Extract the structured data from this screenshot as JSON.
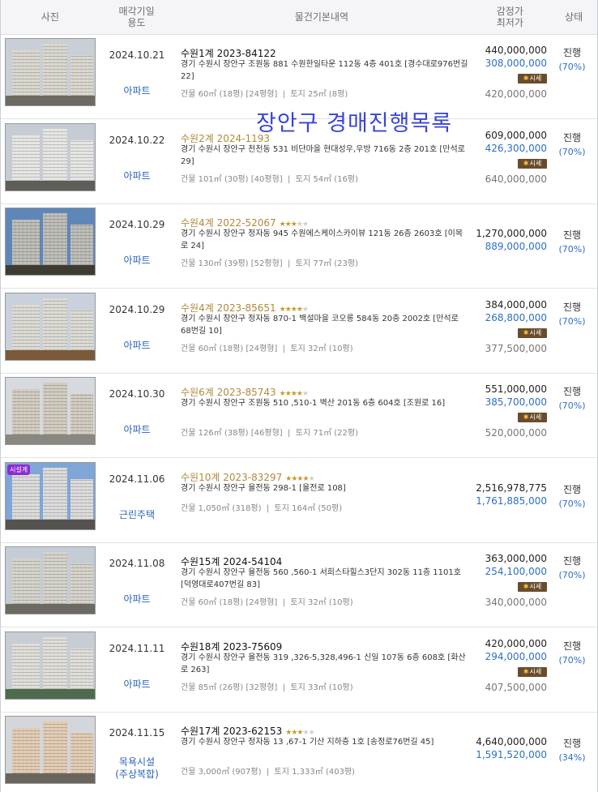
{
  "header": {
    "photo": "사진",
    "date_line1": "매각기일",
    "date_line2": "용도",
    "info": "물건기본내역",
    "price_line1": "감정가",
    "price_line2": "최저가",
    "status": "상태"
  },
  "overlay_title": "장안구 경매진행목록",
  "sise_label": "시세",
  "rows": [
    {
      "date": "2024.10.21",
      "type": "아파트",
      "case": "수원1계 2023-84122",
      "case_style": "plain",
      "stars": 0,
      "addr": "경기 수원시 장안구 조원동 881 수원한일타운 112동 4층 401호 [경수대로976번길 22]",
      "area": "건물 60㎡ (18평) [24평형]  |  토지 25㎡ (8평)",
      "appraisal": "440,000,000",
      "minimum": "308,000,000",
      "prev": "420,000,000",
      "has_sise": true,
      "status": "진행",
      "pct": "(70%)",
      "photo": {
        "sky": "#c9cfd7",
        "bldg": "#d8d5cc",
        "ground": "#6d6a62"
      }
    },
    {
      "date": "2024.10.22",
      "type": "아파트",
      "case": "수원2계 2024-1193",
      "case_style": "gold",
      "stars": 0,
      "addr": "경기 수원시 장안구 천천동 531 비단마을 현대성우,우방 716동 2층 201호 [만석로 29]",
      "area": "건물 101㎡ (30평) [40평형]  |  토지 54㎡ (16평)",
      "appraisal": "609,000,000",
      "minimum": "426,300,000",
      "prev": "640,000,000",
      "has_sise": true,
      "status": "진행",
      "pct": "(70%)",
      "photo": {
        "sky": "#c6ccd3",
        "bldg": "#e4e4e2",
        "ground": "#5f5d57"
      }
    },
    {
      "date": "2024.10.29",
      "type": "아파트",
      "case": "수원4계 2022-52067",
      "case_style": "gold",
      "stars": 3,
      "addr": "경기 수원시 장안구 정자동 945 수원에스케이스카이뷰 121동 26층 2603호 [이목로 24]",
      "area": "건물 130㎡ (39평) [52평형]  |  토지 77㎡ (23평)",
      "appraisal": "1,270,000,000",
      "minimum": "889,000,000",
      "prev": "",
      "has_sise": false,
      "status": "진행",
      "pct": "(70%)",
      "photo": {
        "sky": "#5f86b8",
        "bldg": "#b9b9b4",
        "ground": "#3e3b33"
      }
    },
    {
      "date": "2024.10.29",
      "type": "아파트",
      "case": "수원4계 2023-85651",
      "case_style": "gold",
      "stars": 4,
      "addr": "경기 수원시 장안구 정자동 870-1 백설마을 코오롱 584동 20층 2002호 [만석로68번길 10]",
      "area": "건물 60㎡ (18평) [24평형]  |  토지 32㎡ (10평)",
      "appraisal": "384,000,000",
      "minimum": "268,800,000",
      "prev": "377,500,000",
      "has_sise": true,
      "status": "진행",
      "pct": "(70%)",
      "photo": {
        "sky": "#c8d1dc",
        "bldg": "#dad8d1",
        "ground": "#7a5a3a"
      }
    },
    {
      "date": "2024.10.30",
      "type": "아파트",
      "case": "수원6계 2023-85743",
      "case_style": "gold",
      "stars": 4,
      "addr": "경기 수원시 장안구 조원동 510 ,510-1 벽산 201동 6층 604호 [조원로 16]",
      "area": "건물 126㎡ (38평) [46평형]  |  토지 71㎡ (22평)",
      "appraisal": "551,000,000",
      "minimum": "385,700,000",
      "prev": "520,000,000",
      "has_sise": true,
      "status": "진행",
      "pct": "(70%)",
      "photo": {
        "sky": "#d6d9de",
        "bldg": "#cfc9bd",
        "ground": "#8a8780"
      }
    },
    {
      "date": "2024.11.06",
      "type": "근린주택",
      "case": "수원10계 2023-83297",
      "case_style": "gold",
      "stars": 4,
      "addr": "경기 수원시 장안구 율전동 298-1 [율전로 108]",
      "area": "건물 1,050㎡ (318평)  |  토지 164㎡ (50평)",
      "appraisal": "2,516,978,775",
      "minimum": "1,761,885,000",
      "prev": "",
      "has_sise": false,
      "status": "진행",
      "pct": "(70%)",
      "badge": "시설계",
      "photo": {
        "sky": "#7fa6d6",
        "bldg": "#d9d9d9",
        "ground": "#555350"
      }
    },
    {
      "date": "2024.11.08",
      "type": "아파트",
      "case": "수원15계 2024-54104",
      "case_style": "plain",
      "stars": 0,
      "addr": "경기 수원시 장안구 율전동 560 ,560-1 서희스타힐스3단지 302동 11층 1101호 [덕영대로407번길 83]",
      "area": "건물 60㎡ (18평) [24평형]  |  토지 32㎡ (10평)",
      "appraisal": "363,000,000",
      "minimum": "254,100,000",
      "prev": "340,000,000",
      "has_sise": true,
      "status": "진행",
      "pct": "(70%)",
      "photo": {
        "sky": "#c4ccd6",
        "bldg": "#d3d0c8",
        "ground": "#6b6960"
      }
    },
    {
      "date": "2024.11.11",
      "type": "아파트",
      "case": "수원18계 2023-75609",
      "case_style": "plain",
      "stars": 0,
      "addr": "경기 수원시 장안구 율전동 319 ,326-5,328,496-1 신일 107동 6층 608호 [화산로 263]",
      "area": "건물 85㎡ (26평) [32평형]  |  토지 33㎡ (10평)",
      "appraisal": "420,000,000",
      "minimum": "294,000,000",
      "prev": "407,500,000",
      "has_sise": true,
      "status": "진행",
      "pct": "(70%)",
      "photo": {
        "sky": "#c7cdd4",
        "bldg": "#dddcd6",
        "ground": "#4e6b4e"
      }
    },
    {
      "date": "2024.11.15",
      "type": "목욕시설\n(주상복합)",
      "case": "수원17계 2023-62153",
      "case_style": "plain",
      "stars": 3,
      "addr": "경기 수원시 장안구 정자동 13 ,67-1 기산 지하층 1호 [송정로76번길 45]",
      "area": "건물 3,000㎡ (907평)  |  토지 1,333㎡ (403평)",
      "appraisal": "4,640,000,000",
      "minimum": "1,591,520,000",
      "prev": "",
      "has_sise": false,
      "status": "진행",
      "pct": "(34%)",
      "photo": {
        "sky": "#d3d6da",
        "bldg": "#e0c9b0",
        "ground": "#6a655c"
      }
    }
  ]
}
